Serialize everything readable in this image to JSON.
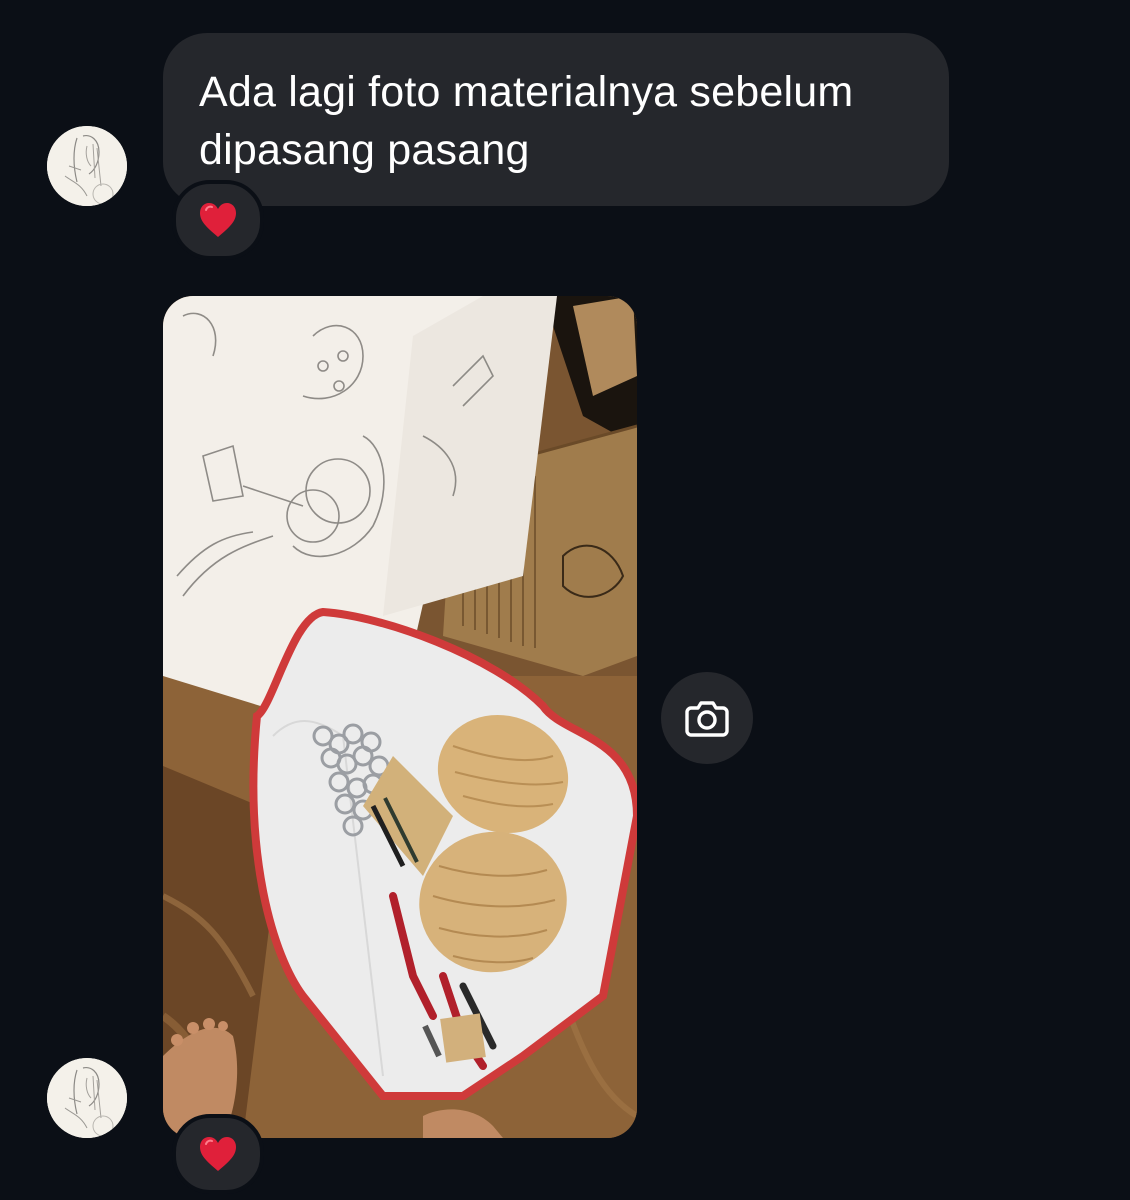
{
  "messages": [
    {
      "type": "text",
      "text": "Ada lagi foto materialnya sebelum dipasang pasang",
      "reaction": "red-heart-emoji"
    },
    {
      "type": "photo",
      "content": "photo-of-sketches-wooden-discs-chain-rings-and-pliers-in-bag",
      "reaction": "red-heart-emoji"
    }
  ],
  "icons": {
    "share": "camera-icon",
    "avatar": "sketch-avatar"
  },
  "colors": {
    "background": "#0b0f16",
    "bubble": "#25272c",
    "text": "#ffffff",
    "heart": "#e0203a"
  }
}
